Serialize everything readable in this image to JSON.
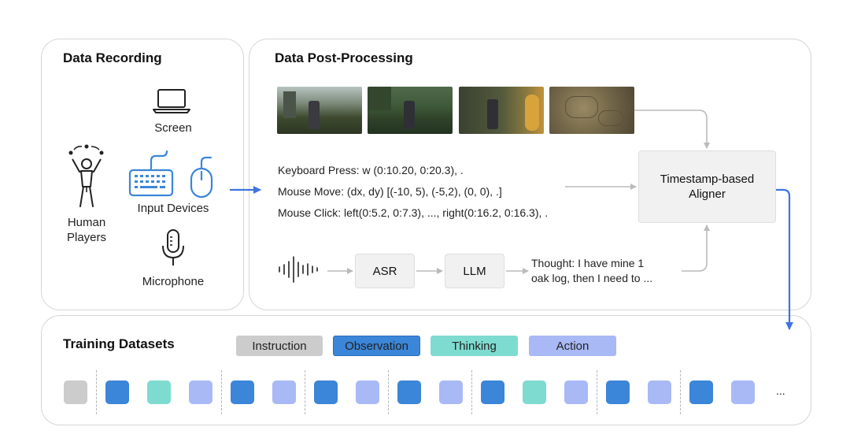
{
  "recording": {
    "title": "Data Recording",
    "screen_label": "Screen",
    "players_label_line1": "Human",
    "players_label_line2": "Players",
    "input_devices_label": "Input Devices",
    "microphone_label": "Microphone",
    "icons": [
      "laptop-icon",
      "juggler-icon",
      "keyboard-icon",
      "mouse-icon",
      "microphone-icon"
    ]
  },
  "post_processing": {
    "title": "Data Post-Processing",
    "keyboard_line": "Keyboard Press: w (0:10.20, 0:20.3), .",
    "mouse_move_line": "Mouse Move: (dx, dy) [(-10, 5), (-5,2), (0, 0), .]",
    "mouse_click_line": "Mouse Click: left(0:5.2, 0:7.3), ..., right(0:16.2, 0:16.3), .",
    "asr_label": "ASR",
    "llm_label": "LLM",
    "thought_line1": "Thought: I have mine 1",
    "thought_line2": "oak log, then I need to ...",
    "aligner_line1": "Timestamp-based",
    "aligner_line2": "Aligner"
  },
  "training": {
    "title": "Training Datasets",
    "legend": [
      {
        "label": "Instruction",
        "color": "#cccccc"
      },
      {
        "label": "Observation",
        "color": "#3b86d8"
      },
      {
        "label": "Thinking",
        "color": "#7edbd0"
      },
      {
        "label": "Action",
        "color": "#a9b9f5"
      }
    ],
    "sequence": [
      "instruction",
      "observation",
      "thinking",
      "action",
      "observation",
      "action",
      "observation",
      "action",
      "observation",
      "action",
      "observation",
      "thinking",
      "action",
      "observation",
      "action",
      "observation",
      "action"
    ],
    "ellipsis": "..."
  },
  "colors": {
    "arrow_blue": "#3f73e0",
    "arrow_gray": "#bbbbbb",
    "instruction": "#cccccc",
    "observation": "#3b86d8",
    "thinking": "#7edbd0",
    "action": "#a9b9f5"
  }
}
